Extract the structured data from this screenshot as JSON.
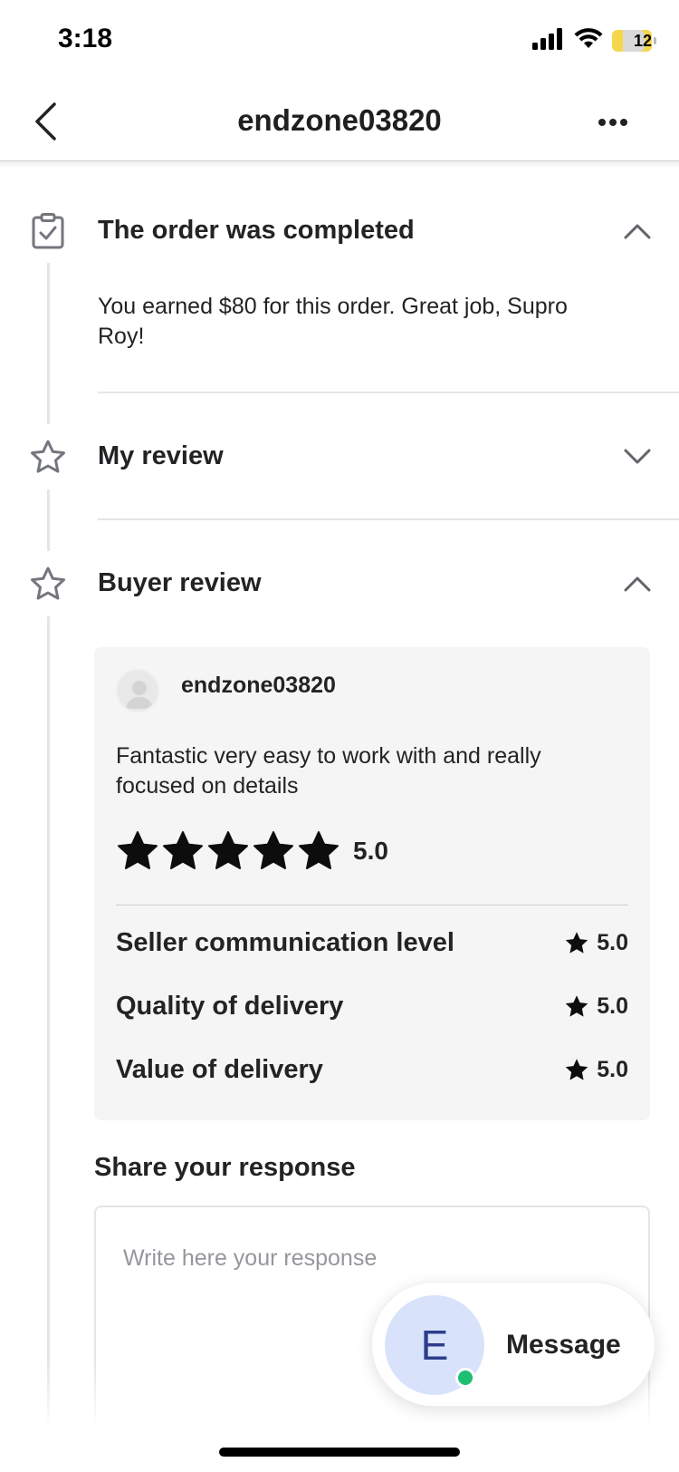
{
  "status_bar": {
    "time": "3:18",
    "battery_level": "12",
    "icons": [
      "signal-icon",
      "wifi-icon",
      "battery-icon"
    ]
  },
  "header": {
    "title": "endzone03820",
    "back_icon": "chevron-left-icon",
    "more_icon": "more-dots-icon"
  },
  "sections": {
    "completed": {
      "title": "The order was completed",
      "icon": "clipboard-check-icon",
      "text": "You earned $80 for this order. Great job, Supro Roy!",
      "expanded": true
    },
    "my_review": {
      "title": "My review",
      "icon": "star-outline-icon",
      "expanded": false
    },
    "buyer_review": {
      "title": "Buyer review",
      "icon": "star-outline-icon",
      "expanded": true,
      "reviewer_name": "endzone03820",
      "review_text": "Fantastic very easy to work with and really focused on details",
      "overall_rating": "5.0",
      "stars": 5,
      "ratings": [
        {
          "label": "Seller communication level",
          "score": "5.0"
        },
        {
          "label": "Quality of delivery",
          "score": "5.0"
        },
        {
          "label": "Value of delivery",
          "score": "5.0"
        }
      ]
    }
  },
  "response": {
    "title": "Share your response",
    "placeholder": "Write here your response",
    "value": ""
  },
  "message_button": {
    "avatar_letter": "E",
    "label": "Message",
    "online": true
  },
  "colors": {
    "accent_green": "#1dbf73",
    "avatar_bg": "#d8e3fb",
    "avatar_text": "#2b3d8b",
    "card_bg": "#f5f5f5",
    "text_primary": "#222325",
    "placeholder": "#95979d"
  }
}
